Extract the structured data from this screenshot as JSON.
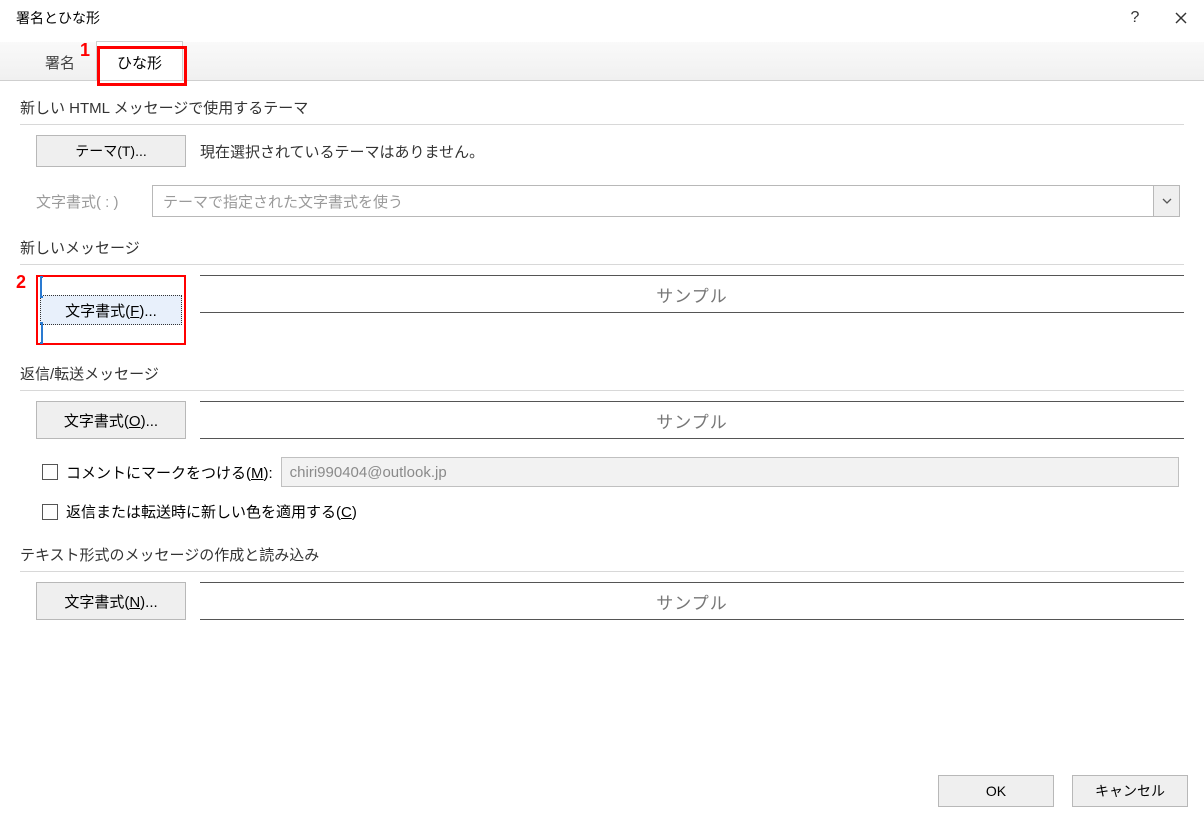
{
  "window": {
    "title": "署名とひな形",
    "help_symbol": "?",
    "close_symbol": "×"
  },
  "tabs": {
    "signature": "署名",
    "stationery": "ひな形"
  },
  "annotations": {
    "n1": "1",
    "n2": "2"
  },
  "section_theme": {
    "heading": "新しい HTML メッセージで使用するテーマ",
    "theme_button": "テーマ(T)...",
    "theme_accel": "T",
    "status": "現在選択されているテーマはありません。",
    "font_format_label": "文字書式( : )",
    "dropdown_text": "テーマで指定された文字書式を使う"
  },
  "section_new": {
    "heading": "新しいメッセージ",
    "button": "文字書式(F)...",
    "accel": "F",
    "sample": "サンプル"
  },
  "section_reply": {
    "heading": "返信/転送メッセージ",
    "button": "文字書式(O)...",
    "accel": "O",
    "sample": "サンプル",
    "checkbox_mark_pre": "コメントにマークをつける(",
    "checkbox_mark_accel": "M",
    "checkbox_mark_post": "):",
    "mark_value": "chiri990404@outlook.jp",
    "checkbox_color_pre": "返信または転送時に新しい色を適用する(",
    "checkbox_color_accel": "C",
    "checkbox_color_post": ")"
  },
  "section_text": {
    "heading": "テキスト形式のメッセージの作成と読み込み",
    "button": "文字書式(N)...",
    "accel": "N",
    "sample": "サンプル"
  },
  "footer": {
    "ok": "OK",
    "cancel": "キャンセル"
  }
}
